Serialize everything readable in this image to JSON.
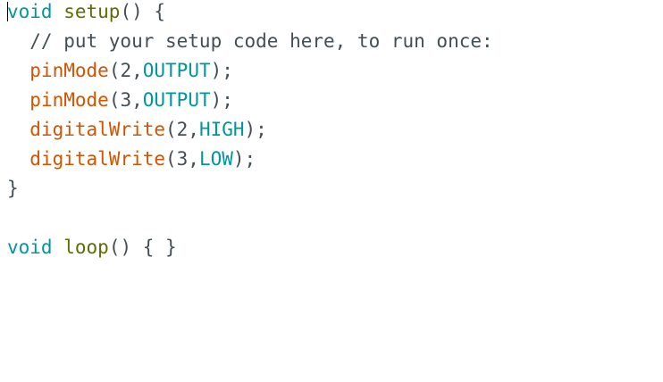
{
  "code": {
    "lines": [
      [
        {
          "t": "void",
          "k": "kw"
        },
        {
          "t": " ",
          "k": "plain"
        },
        {
          "t": "setup",
          "k": "fn"
        },
        {
          "t": "() {",
          "k": "plain"
        }
      ],
      [
        {
          "t": "  // put your setup code here, to run once:",
          "k": "cmt"
        }
      ],
      [
        {
          "t": "  ",
          "k": "plain"
        },
        {
          "t": "pinMode",
          "k": "call"
        },
        {
          "t": "(2,",
          "k": "plain"
        },
        {
          "t": "OUTPUT",
          "k": "kw"
        },
        {
          "t": ");",
          "k": "plain"
        }
      ],
      [
        {
          "t": "  ",
          "k": "plain"
        },
        {
          "t": "pinMode",
          "k": "call"
        },
        {
          "t": "(3,",
          "k": "plain"
        },
        {
          "t": "OUTPUT",
          "k": "kw"
        },
        {
          "t": ");",
          "k": "plain"
        }
      ],
      [
        {
          "t": "  ",
          "k": "plain"
        },
        {
          "t": "digitalWrite",
          "k": "call"
        },
        {
          "t": "(2,",
          "k": "plain"
        },
        {
          "t": "HIGH",
          "k": "kw"
        },
        {
          "t": ");",
          "k": "plain"
        }
      ],
      [
        {
          "t": "  ",
          "k": "plain"
        },
        {
          "t": "digitalWrite",
          "k": "call"
        },
        {
          "t": "(3,",
          "k": "plain"
        },
        {
          "t": "LOW",
          "k": "kw"
        },
        {
          "t": ");",
          "k": "plain"
        }
      ],
      [
        {
          "t": "}",
          "k": "plain"
        }
      ],
      [],
      [
        {
          "t": "void",
          "k": "kw"
        },
        {
          "t": " ",
          "k": "plain"
        },
        {
          "t": "loop",
          "k": "fn"
        },
        {
          "t": "() { }",
          "k": "plain"
        }
      ]
    ]
  },
  "colors": {
    "keyword": "#00979c",
    "function_name": "#5e6d03",
    "call": "#d35400",
    "text": "#434f54",
    "background": "#ffffff"
  }
}
